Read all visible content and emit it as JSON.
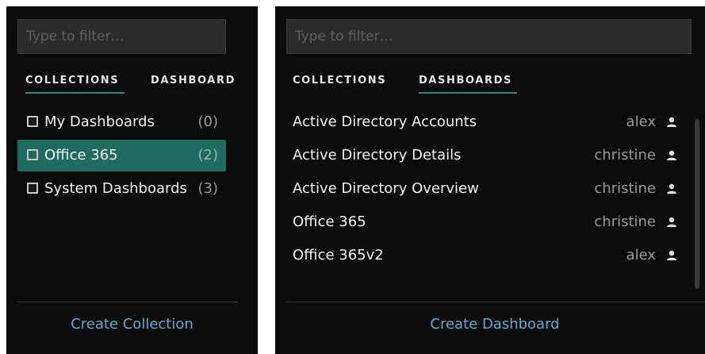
{
  "left_panel": {
    "filter_placeholder": "Type to filter…",
    "tabs": {
      "collections": "COLLECTIONS",
      "dashboards": "DASHBOARD"
    },
    "active_tab": "collections",
    "collections": [
      {
        "label": "My Dashboards",
        "count": "(0)",
        "selected": false,
        "icon": "grid-icon"
      },
      {
        "label": "Office 365",
        "count": "(2)",
        "selected": true,
        "icon": "grid-icon"
      },
      {
        "label": "System Dashboards",
        "count": "(3)",
        "selected": false,
        "icon": "grid-icon"
      }
    ],
    "footer_label": "Create Collection"
  },
  "right_panel": {
    "filter_placeholder": "Type to filter…",
    "tabs": {
      "collections": "COLLECTIONS",
      "dashboards": "DASHBOARDS"
    },
    "active_tab": "dashboards",
    "dashboards": [
      {
        "title": "Active Directory Accounts",
        "owner": "alex",
        "icon": "person-icon"
      },
      {
        "title": "Active Directory Details",
        "owner": "christine",
        "icon": "person-icon"
      },
      {
        "title": "Active Directory Overview",
        "owner": "christine",
        "icon": "person-icon"
      },
      {
        "title": "Office 365",
        "owner": "christine",
        "icon": "person-icon"
      },
      {
        "title": "Office 365v2",
        "owner": "alex",
        "icon": "person-icon"
      }
    ],
    "footer_label": "Create Dashboard"
  },
  "colors": {
    "panel_bg": "#0b0b0b",
    "selected_bg": "#1f6b60",
    "tab_underline": "#2f8c7c",
    "link": "#6aa9c9"
  }
}
